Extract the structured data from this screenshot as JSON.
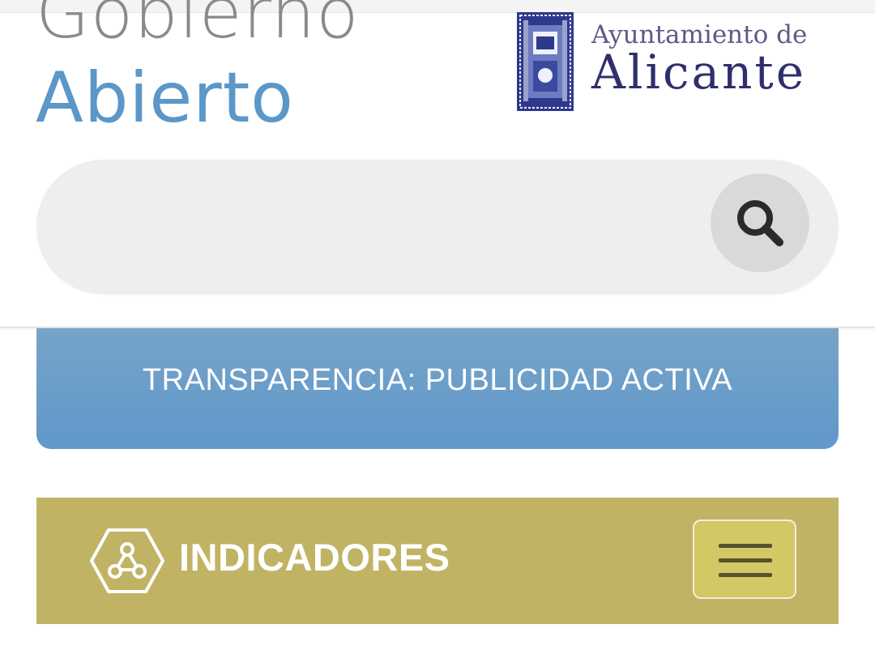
{
  "header": {
    "brand_line1": "Gobierno",
    "brand_line2": "Abierto",
    "city_small": "Ayuntamiento de",
    "city_big": "Alicante",
    "shield_icon": "coat-of-arms-icon"
  },
  "search": {
    "value": "",
    "placeholder": "",
    "button_icon": "search-icon"
  },
  "nav": {
    "transparency_label": "TRANSPARENCIA: PUBLICIDAD ACTIVA",
    "indicators_label": "INDICADORES",
    "indicators_icon": "network-hexagon-icon",
    "menu_icon": "hamburger-menu-icon"
  },
  "colors": {
    "brand_grey": "#8a8a8a",
    "brand_blue": "#5b97c8",
    "city_navy": "#2f2f6e",
    "transparency_bg": "#6197cb",
    "indicators_bg": "#c0b464",
    "menu_btn_bg": "#d2c866"
  }
}
